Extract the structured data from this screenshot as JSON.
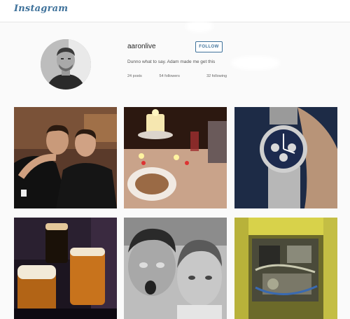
{
  "app": {
    "logo_text": "Instagram",
    "brand_color": "#3f729b"
  },
  "profile": {
    "username": "aaronlive",
    "follow_label": "FOLLOW",
    "bio": "Dunno what to say. Adam made me get this",
    "stats": {
      "posts": "24 posts",
      "followers": "54 followers",
      "following": "32 following"
    }
  },
  "photos": [
    {
      "subject": "two-men-hugging-photo"
    },
    {
      "subject": "candlelit-dinner-photo"
    },
    {
      "subject": "luxury-watch-photo"
    },
    {
      "subject": "beer-glasses-photo"
    },
    {
      "subject": "two-men-selfie-photo"
    },
    {
      "subject": "car-engine-photo"
    }
  ]
}
